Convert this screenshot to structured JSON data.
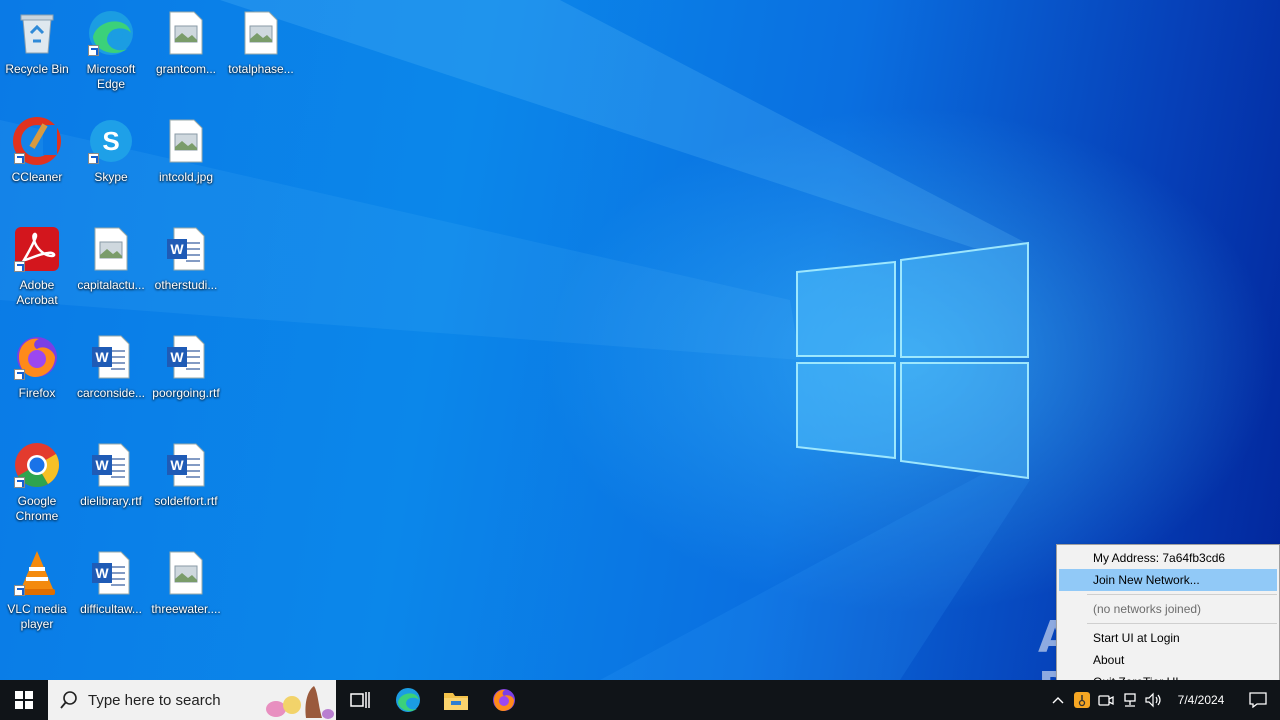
{
  "desktop": {
    "icons": [
      {
        "label": "Recycle Bin",
        "icon": "recycle-bin-icon"
      },
      {
        "label": "Microsoft Edge",
        "icon": "edge-icon"
      },
      {
        "label": "grantcom...",
        "icon": "image-file-icon"
      },
      {
        "label": "totalphase...",
        "icon": "image-file-icon"
      },
      {
        "label": "CCleaner",
        "icon": "ccleaner-icon"
      },
      {
        "label": "Skype",
        "icon": "skype-icon"
      },
      {
        "label": "intcold.jpg",
        "icon": "image-file-icon"
      },
      {
        "label": "Adobe Acrobat",
        "icon": "acrobat-icon"
      },
      {
        "label": "capitalactu...",
        "icon": "image-file-icon"
      },
      {
        "label": "otherstudi...",
        "icon": "word-doc-icon"
      },
      {
        "label": "Firefox",
        "icon": "firefox-icon"
      },
      {
        "label": "carconside...",
        "icon": "word-doc-icon"
      },
      {
        "label": "poorgoing.rtf",
        "icon": "word-doc-icon"
      },
      {
        "label": "Google Chrome",
        "icon": "chrome-icon"
      },
      {
        "label": "dielibrary.rtf",
        "icon": "word-doc-icon"
      },
      {
        "label": "soldeffort.rtf",
        "icon": "word-doc-icon"
      },
      {
        "label": "VLC media player",
        "icon": "vlc-icon"
      },
      {
        "label": "difficultaw...",
        "icon": "word-doc-icon"
      },
      {
        "label": "threewater....",
        "icon": "image-file-icon"
      }
    ]
  },
  "taskbar": {
    "search_placeholder": "Type here to search",
    "pinned": [
      "task-view-icon",
      "edge-icon",
      "file-explorer-icon",
      "firefox-icon"
    ],
    "clock_date": "7/4/2024"
  },
  "context_menu": {
    "address_label": "My Address:  7a64fb3cd6",
    "join": "Join New Network...",
    "no_networks": "(no networks joined)",
    "start_ui": "Start UI at Login",
    "about": "About",
    "quit": "Quit ZeroTier UI"
  },
  "watermark": "ANY RUN",
  "colors": {
    "menu_highlight": "#91c9f7",
    "taskbar": "#101418",
    "wallpaper_blue": "#0a7ae6"
  }
}
